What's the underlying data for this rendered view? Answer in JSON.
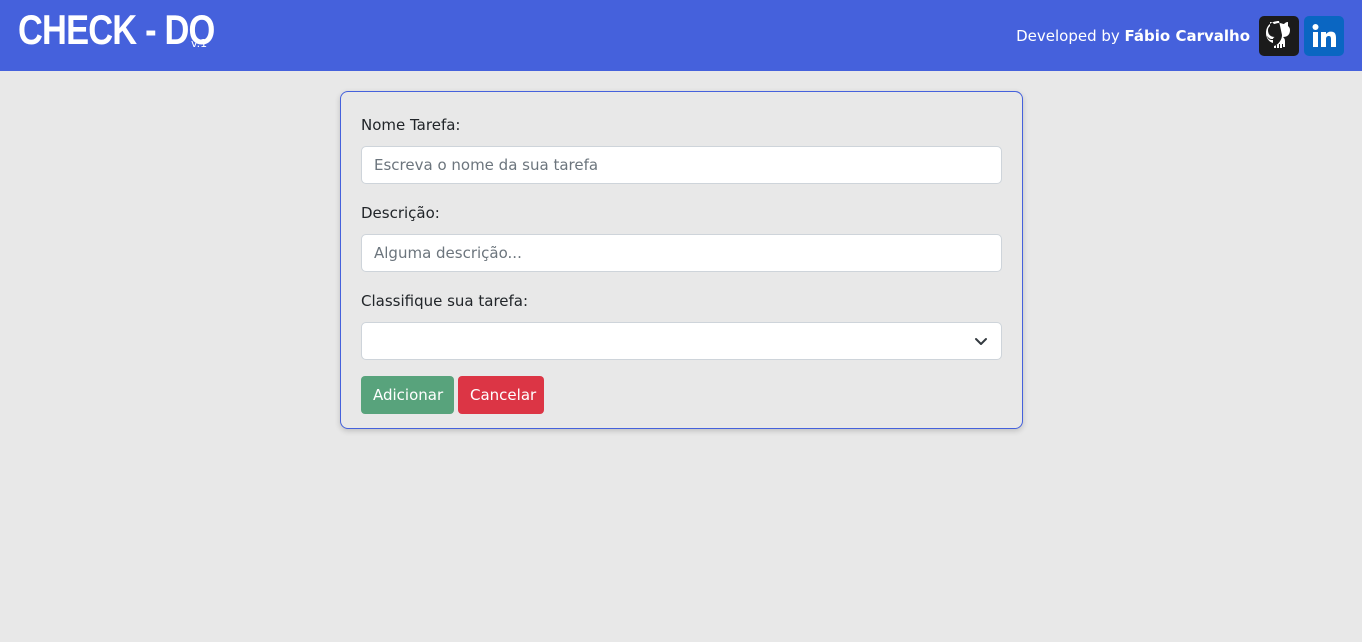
{
  "header": {
    "title": "CHECK - DO",
    "version": "v.1",
    "developed_by": "Developed by",
    "author": "Fábio Carvalho",
    "icons": [
      "github-icon",
      "linkedin-icon"
    ]
  },
  "form": {
    "name_label": "Nome Tarefa:",
    "name_placeholder": "Escreva o nome da sua tarefa",
    "desc_label": "Descrição:",
    "desc_placeholder": "Alguma descrição...",
    "class_label": "Classifique sua tarefa:",
    "class_value": ""
  },
  "buttons": {
    "add": "Adicionar",
    "cancel": "Cancelar"
  },
  "colors": {
    "navbar": "#4561dc",
    "add_button": "#58a37c",
    "cancel_button": "#dc3545"
  }
}
